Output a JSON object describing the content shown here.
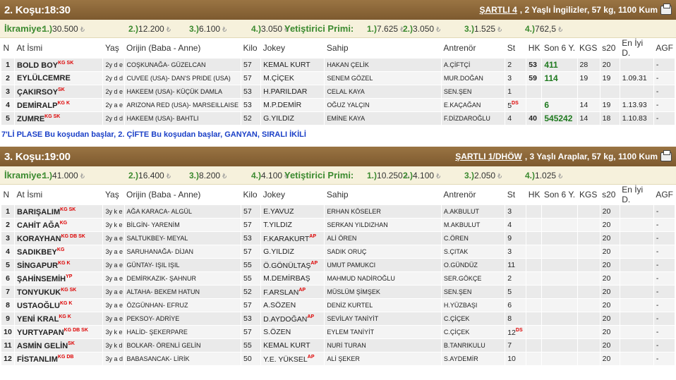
{
  "columns": [
    "N",
    "At İsmi",
    "Yaş",
    "Orijin (Baba - Anne)",
    "Kilo",
    "Jokey",
    "Sahip",
    "Antrenör",
    "St",
    "HK",
    "Son 6 Y.",
    "KGS",
    "s20",
    "En İyi D.",
    "AGF"
  ],
  "currency": "₺",
  "prize_labels": {
    "prize": "İkramiye:",
    "breeder": "Yetiştirici Primi:"
  },
  "races": [
    {
      "title": "2. Koşu:18:30",
      "condition": "ŞARTLI 4",
      "info": ", 2 Yaşlı İngilizler, 57 kg, 1100 Kum",
      "prizes": [
        [
          "1.)",
          "30.500"
        ],
        [
          "2.)",
          "12.200"
        ],
        [
          "3.)",
          "6.100"
        ],
        [
          "4.)",
          "3.050"
        ]
      ],
      "breeder": [
        [
          "1.)",
          "7.625"
        ],
        [
          "2.)",
          "3.050"
        ],
        [
          "3.)",
          "1.525"
        ],
        [
          "4.)",
          "762,5"
        ]
      ],
      "rows": [
        {
          "n": "1",
          "name": "BOLD BOY",
          "eq": "KG SK",
          "age": "2y d e",
          "origin": "COŞKUNAĞA- GÜZELCAN",
          "kilo": "57",
          "jokey": "KEMAL KURT",
          "jap": "",
          "sahip": "HAKAN ÇELİK",
          "trainer": "A.ÇİFTÇİ",
          "st": "2",
          "stx": "",
          "hk": "53",
          "son6": "411",
          "kgs": "28",
          "s20": "20",
          "best": "",
          "agf": "-"
        },
        {
          "n": "2",
          "name": "EYLÜLCEMRE",
          "eq": "",
          "age": "2y d d",
          "origin": "CUVEE (USA)- DAN'S PRIDE (USA)",
          "kilo": "57",
          "jokey": "M.ÇİÇEK",
          "jap": "",
          "sahip": "SENEM GÖZEL",
          "trainer": "MUR.DOĞAN",
          "st": "3",
          "stx": "",
          "hk": "59",
          "son6": "114",
          "kgs": "19",
          "s20": "19",
          "best": "1.09.31",
          "agf": "-"
        },
        {
          "n": "3",
          "name": "ÇAKIRSOY",
          "eq": "SK",
          "age": "2y d e",
          "origin": "HAKEEM (USA)- KÜÇÜK DAMLA",
          "kilo": "53",
          "jokey": "H.PARILDAR",
          "jap": "",
          "sahip": "CELAL KAYA",
          "trainer": "SEN.ŞEN",
          "st": "1",
          "stx": "",
          "hk": "",
          "son6": "",
          "kgs": "",
          "s20": "",
          "best": "",
          "agf": "-"
        },
        {
          "n": "4",
          "name": "DEMİRALP",
          "eq": "KG K",
          "age": "2y a e",
          "origin": "ARIZONA RED (USA)- MARSEILLAISE",
          "kilo": "53",
          "jokey": "M.P.DEMİR",
          "jap": "",
          "sahip": "OĞUZ YALÇIN",
          "trainer": "E.KAÇAĞAN",
          "st": "5",
          "stx": "DS",
          "hk": "",
          "son6": "6",
          "kgs": "14",
          "s20": "19",
          "best": "1.13.93",
          "agf": "-"
        },
        {
          "n": "5",
          "name": "ZUMRE",
          "eq": "KG SK",
          "age": "2y d d",
          "origin": "HAKEEM (USA)- BAHTLI",
          "kilo": "52",
          "jokey": "G.YILDIZ",
          "jap": "",
          "sahip": "EMİNE KAYA",
          "trainer": "F.DİZDAROĞLU",
          "st": "4",
          "stx": "",
          "hk": "40",
          "son6": "545242",
          "kgs": "14",
          "s20": "18",
          "best": "1.10.83",
          "agf": "-"
        }
      ],
      "notes": "7'Lİ PLASE Bu koşudan başlar, 2. ÇİFTE Bu koşudan başlar, GANYAN, SIRALI İKİLİ"
    },
    {
      "title": "3. Koşu:19:00",
      "condition": "ŞARTLI 1/DHÖW",
      "info": ", 3 Yaşlı Araplar, 57 kg, 1100 Kum",
      "prizes": [
        [
          "1.)",
          "41.000"
        ],
        [
          "2.)",
          "16.400"
        ],
        [
          "3.)",
          "8.200"
        ],
        [
          "4.)",
          "4.100"
        ]
      ],
      "breeder": [
        [
          "1.)",
          "10.250"
        ],
        [
          "2.)",
          "4.100"
        ],
        [
          "3.)",
          "2.050"
        ],
        [
          "4.)",
          "1.025"
        ]
      ],
      "rows": [
        {
          "n": "1",
          "name": "BARIŞALIM",
          "eq": "KG SK",
          "age": "3y k e",
          "origin": "AĞA KARACA- ALGÜL",
          "kilo": "57",
          "jokey": "E.YAVUZ",
          "jap": "",
          "sahip": "ERHAN KÖSELER",
          "trainer": "A.AKBULUT",
          "st": "3",
          "stx": "",
          "hk": "",
          "son6": "",
          "kgs": "",
          "s20": "20",
          "best": "",
          "agf": "-"
        },
        {
          "n": "2",
          "name": "CAHİT AĞA",
          "eq": "KG",
          "age": "3y k e",
          "origin": "BİLGİN- YARENİM",
          "kilo": "57",
          "jokey": "T.YILDIZ",
          "jap": "",
          "sahip": "SERKAN YILDIZHAN",
          "trainer": "M.AKBULUT",
          "st": "4",
          "stx": "",
          "hk": "",
          "son6": "",
          "kgs": "",
          "s20": "20",
          "best": "",
          "agf": "-"
        },
        {
          "n": "3",
          "name": "KORAYHAN",
          "eq": "KG DB SK",
          "age": "3y a e",
          "origin": "SALTUKBEY- MEYAL",
          "kilo": "53",
          "jokey": "F.KARAKURT",
          "jap": "AP",
          "sahip": "ALİ ÖREN",
          "trainer": "C.ÖREN",
          "st": "9",
          "stx": "",
          "hk": "",
          "son6": "",
          "kgs": "",
          "s20": "20",
          "best": "",
          "agf": "-"
        },
        {
          "n": "4",
          "name": "SADIKBEY",
          "eq": "KG",
          "age": "3y a e",
          "origin": "SARUHANAĞA- DİJAN",
          "kilo": "57",
          "jokey": "G.YILDIZ",
          "jap": "",
          "sahip": "SADIK ORUÇ",
          "trainer": "S.ÇITAK",
          "st": "3",
          "stx": "",
          "hk": "",
          "son6": "",
          "kgs": "",
          "s20": "20",
          "best": "",
          "agf": "-"
        },
        {
          "n": "5",
          "name": "SİNGAPUR",
          "eq": "KG K",
          "age": "3y a e",
          "origin": "GÜNTAY- IŞIL IŞIL",
          "kilo": "55",
          "jokey": "Ö.GÖNÜLTAŞ",
          "jap": "AP",
          "sahip": "UMUT PAMUKCI",
          "trainer": "O.GÜNDÜZ",
          "st": "11",
          "stx": "",
          "hk": "",
          "son6": "",
          "kgs": "",
          "s20": "20",
          "best": "",
          "agf": "-"
        },
        {
          "n": "6",
          "name": "ŞAHİNSEMİH",
          "eq": "YP",
          "age": "3y a e",
          "origin": "DEMİRKAZIK- ŞAHNUR",
          "kilo": "55",
          "jokey": "M.DEMİRBAŞ",
          "jap": "",
          "sahip": "MAHMUD NADİROĞLU",
          "trainer": "SER.GÖKÇE",
          "st": "2",
          "stx": "",
          "hk": "",
          "son6": "",
          "kgs": "",
          "s20": "20",
          "best": "",
          "agf": "-"
        },
        {
          "n": "7",
          "name": "TONYUKUK",
          "eq": "KG SK",
          "age": "3y a e",
          "origin": "ALTAHA- BEKEM HATUN",
          "kilo": "52",
          "jokey": "F.ARSLAN",
          "jap": "AP",
          "sahip": "MÜSLÜM ŞİMŞEK",
          "trainer": "SEN.ŞEN",
          "st": "5",
          "stx": "",
          "hk": "",
          "son6": "",
          "kgs": "",
          "s20": "20",
          "best": "",
          "agf": "-"
        },
        {
          "n": "8",
          "name": "USTAOĞLU",
          "eq": "KG K",
          "age": "3y a e",
          "origin": "ÖZGÜNHAN- EFRUZ",
          "kilo": "57",
          "jokey": "A.SÖZEN",
          "jap": "",
          "sahip": "DENİZ KURTEL",
          "trainer": "H.YÜZBAŞI",
          "st": "6",
          "stx": "",
          "hk": "",
          "son6": "",
          "kgs": "",
          "s20": "20",
          "best": "",
          "agf": "-"
        },
        {
          "n": "9",
          "name": "YENİ KRAL",
          "eq": "KG K",
          "age": "3y a e",
          "origin": "PEKSOY- ADRİYE",
          "kilo": "53",
          "jokey": "D.AYDOĞAN",
          "jap": "AP",
          "sahip": "SEVİLAY TANİYİT",
          "trainer": "C.ÇİÇEK",
          "st": "8",
          "stx": "",
          "hk": "",
          "son6": "",
          "kgs": "",
          "s20": "20",
          "best": "",
          "agf": "-"
        },
        {
          "n": "10",
          "name": "YURTYAPAN",
          "eq": "KG DB SK",
          "age": "3y k e",
          "origin": "HALİD- ŞEKERPARE",
          "kilo": "57",
          "jokey": "S.ÖZEN",
          "jap": "",
          "sahip": "EYLEM TANİYİT",
          "trainer": "C.ÇİÇEK",
          "st": "12",
          "stx": "DS",
          "hk": "",
          "son6": "",
          "kgs": "",
          "s20": "20",
          "best": "",
          "agf": "-"
        },
        {
          "n": "11",
          "name": "ASMİN GELİN",
          "eq": "SK",
          "age": "3y k d",
          "origin": "BOLKAR- ÖRENLİ GELİN",
          "kilo": "55",
          "jokey": "KEMAL KURT",
          "jap": "",
          "sahip": "NURİ TURAN",
          "trainer": "B.TANRIKULU",
          "st": "7",
          "stx": "",
          "hk": "",
          "son6": "",
          "kgs": "",
          "s20": "20",
          "best": "",
          "agf": "-"
        },
        {
          "n": "12",
          "name": "FİSTANLIM",
          "eq": "KG DB",
          "age": "3y a d",
          "origin": "BABASANCAK- LİRİK",
          "kilo": "50",
          "jokey": "Y.E. YÜKSEL",
          "jap": "AP",
          "sahip": "ALİ ŞEKER",
          "trainer": "S.AYDEMİR",
          "st": "10",
          "stx": "",
          "hk": "",
          "son6": "",
          "kgs": "",
          "s20": "20",
          "best": "",
          "agf": "-"
        }
      ],
      "notes": ""
    }
  ]
}
